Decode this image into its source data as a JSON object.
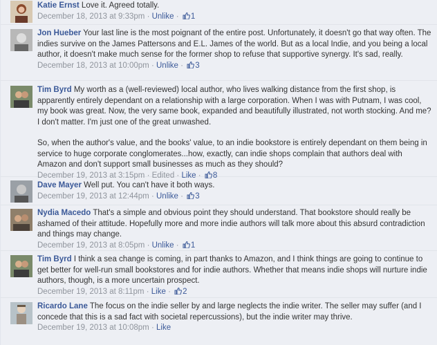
{
  "comments": [
    {
      "author": "Katie Ernst",
      "paragraphs": [
        "Love it. Agreed totally."
      ],
      "timestamp": "December 18, 2013 at 9:33pm",
      "action": "Unlike",
      "edited": "",
      "likes": "1"
    },
    {
      "author": "Jon Hueber",
      "paragraphs": [
        "Your last line is the most poignant of the entire post. Unfortunately, it doesn't go that way often. The indies survive on the James Pattersons and E.L. James of the world. But as a local Indie, and you being a local author, it doesn't make much sense for the former shop to refuse that supportive synergy. It's sad, really."
      ],
      "timestamp": "December 18, 2013 at 10:00pm",
      "action": "Unlike",
      "edited": "",
      "likes": "3"
    },
    {
      "author": "Tim Byrd",
      "paragraphs": [
        "My worth as a (well-reviewed) local author, who lives walking distance from the first shop, is apparently entirely dependant on a relationship with a large corporation. When I was with Putnam, I was cool, my book was great. Now, the very same book, expanded and beautifully illustrated, not worth stocking. And me? I don't matter. I'm just one of the great unwashed.",
        "So, when the author's value, and the books' value, to an indie bookstore is entirely dependant on them being in service to huge corporate conglomerates...how, exactly, can indie shops complain that authors deal with Amazon and don't support small businesses as much as they should?"
      ],
      "timestamp": "December 19, 2013 at 3:15pm",
      "action": "Like",
      "edited": "Edited",
      "likes": "8"
    },
    {
      "author": "Dave Mayer",
      "paragraphs": [
        "Well put. You can't have it both ways."
      ],
      "timestamp": "December 19, 2013 at 12:44pm",
      "action": "Unlike",
      "edited": "",
      "likes": "3"
    },
    {
      "author": "Nydia Macedo",
      "paragraphs": [
        "That's a simple and obvious point they should understand. That bookstore should really be ashamed of their attitude. Hopefully more and more indie authors will talk more about this absurd contradiction and things may change."
      ],
      "timestamp": "December 19, 2013 at 8:05pm",
      "action": "Unlike",
      "edited": "",
      "likes": "1"
    },
    {
      "author": "Tim Byrd",
      "paragraphs": [
        "I think a sea change is coming, in part thanks to Amazon, and I think things are going to continue to get better for well-run small bookstores and for indie authors. Whether that means indie shops will nurture indie authors, though, is a more uncertain prospect."
      ],
      "timestamp": "December 19, 2013 at 8:11pm",
      "action": "Like",
      "edited": "",
      "likes": "2"
    },
    {
      "author": "Ricardo Lane",
      "paragraphs": [
        "The focus on the indie seller by and large neglects the indie writer. The seller may suffer (and I concede that this is a sad fact with societal repercussions), but the indie writer may thrive."
      ],
      "timestamp": "December 19, 2013 at 10:08pm",
      "action": "Like",
      "edited": "",
      "likes": ""
    }
  ]
}
